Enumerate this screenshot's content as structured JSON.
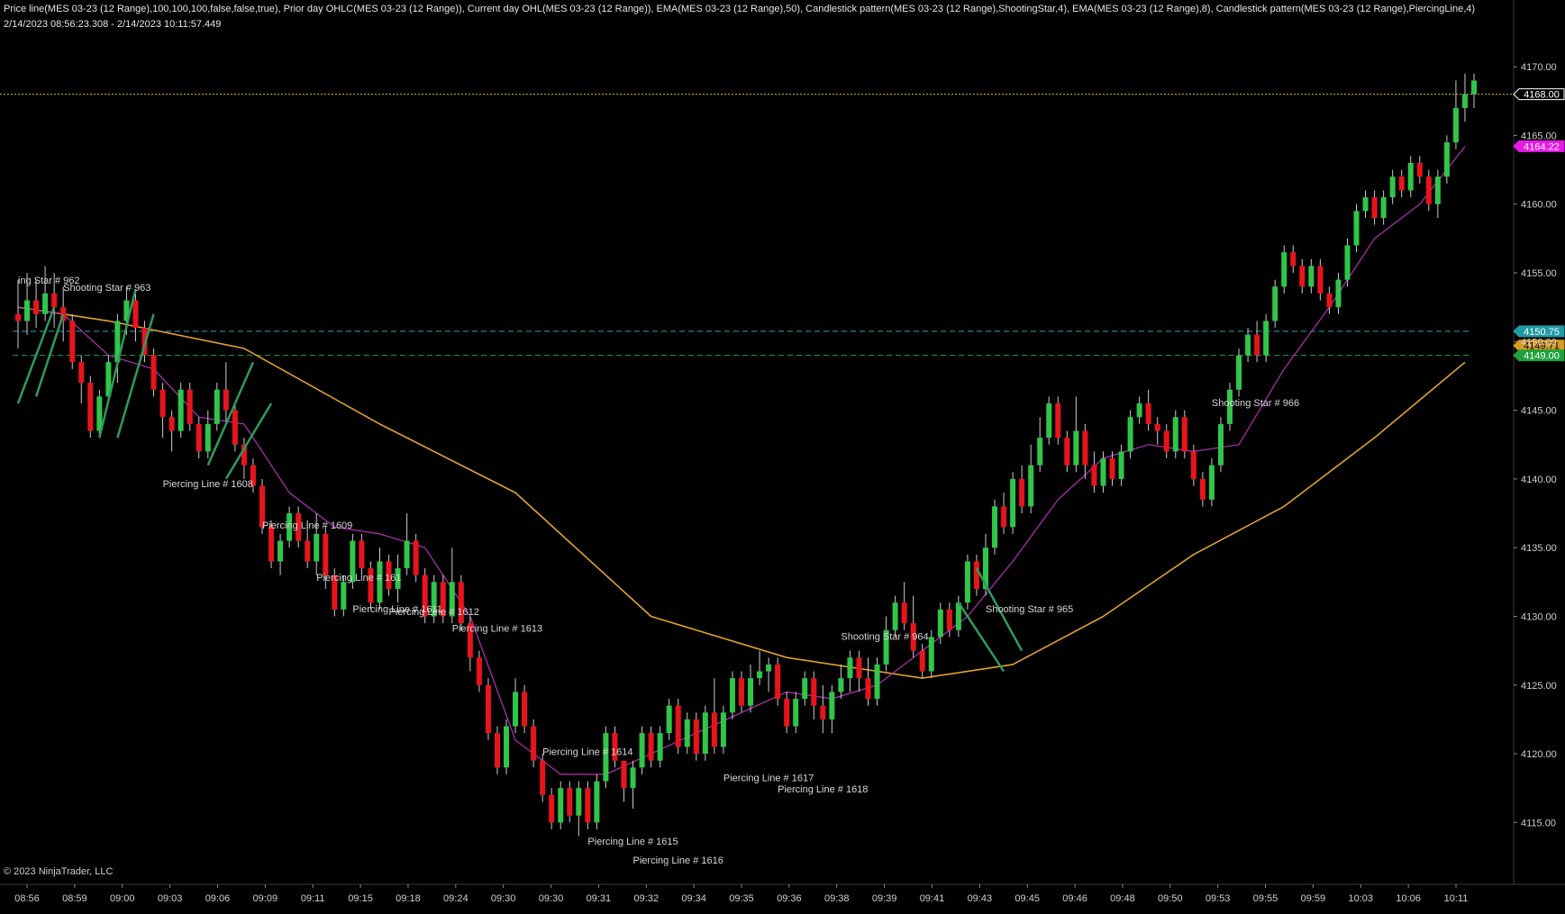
{
  "header": {
    "indicators": "Price line(MES 03-23 (12 Range),100,100,100,false,false,true), Prior day OHLC(MES 03-23 (12 Range)), Current day OHL(MES 03-23 (12 Range)), EMA(MES 03-23 (12 Range),50), Candlestick pattern(MES 03-23 (12 Range),ShootingStar,4), EMA(MES 03-23 (12 Range),8), Candlestick pattern(MES 03-23 (12 Range),PiercingLine,4)",
    "range": "2/14/2023 08:56:23.308 - 2/14/2023 10:11:57.449"
  },
  "footer": {
    "copyright": "© 2023 NinjaTrader, LLC"
  },
  "colors": {
    "background": "#000000",
    "up": "#2fc64a",
    "down": "#e8141c",
    "neutral_up": "#d8d8d8",
    "neutral_down": "#8a8a8a",
    "wick": "#cccccc",
    "ema50": "#e0a22a",
    "ema8": "#b52fb8",
    "price_line": "#d4c01a",
    "prior_line": "#2aa7b2",
    "current_open_line": "#1fa23a",
    "pattern_line": "#2e9b5e",
    "axis_text": "#d0d0d0",
    "label_text": "#d8d8d8"
  },
  "chart_data": {
    "type": "candlestick",
    "y_axis": {
      "ticks": [
        "4170.00",
        "4165.00",
        "4160.00",
        "4155.00",
        "4150.00",
        "4145.00",
        "4140.00",
        "4135.00",
        "4130.00",
        "4125.00",
        "4120.00",
        "4115.00"
      ],
      "range": [
        4110.5,
        4172.5
      ]
    },
    "x_axis": {
      "ticks": [
        "08:56",
        "08:59",
        "09:00",
        "09:03",
        "09:06",
        "09:09",
        "09:11",
        "09:15",
        "09:18",
        "09:24",
        "09:30",
        "09:30",
        "09:31",
        "09:32",
        "09:34",
        "09:35",
        "09:36",
        "09:38",
        "09:39",
        "09:41",
        "09:43",
        "09:45",
        "09:46",
        "09:48",
        "09:50",
        "09:53",
        "09:55",
        "09:59",
        "10:03",
        "10:06",
        "10:11"
      ]
    },
    "price_markers": [
      {
        "label": "4168.00",
        "value": 4168.0,
        "bg": "#000000",
        "fg": "#ffffff",
        "border": "#ffffff"
      },
      {
        "label": "4164.22",
        "value": 4164.22,
        "bg": "#e619e6",
        "fg": "#ffffff",
        "border": "#e619e6"
      },
      {
        "label": "4150.75",
        "value": 4150.75,
        "bg": "#1f9aa6",
        "fg": "#ffffff",
        "border": "#1f9aa6"
      },
      {
        "label": "4149.71",
        "value": 4149.71,
        "bg": "#d69b22",
        "fg": "#000000",
        "border": "#d69b22"
      },
      {
        "label": "4149.00",
        "value": 4149.0,
        "bg": "#1fa23a",
        "fg": "#ffffff",
        "border": "#1fa23a"
      }
    ],
    "horizontal_lines": [
      {
        "name": "Price line",
        "value": 4168.0,
        "style": "dotted"
      },
      {
        "name": "Prior day OHLC",
        "value": 4150.75,
        "style": "dashed"
      },
      {
        "name": "Current day OHL",
        "value": 4149.0,
        "style": "dashed"
      }
    ],
    "candles": [
      [
        4152,
        4151.5,
        4154.5,
        4149.5
      ],
      [
        4151.5,
        4153,
        4155,
        4150.5
      ],
      [
        4153,
        4152,
        4154.5,
        4151
      ],
      [
        4152,
        4153.5,
        4155.5,
        4151.5
      ],
      [
        4153.5,
        4152.5,
        4155,
        4151
      ],
      [
        4152.5,
        4151.5,
        4154,
        4150
      ],
      [
        4151.5,
        4148.5,
        4152,
        4148
      ],
      [
        4148.5,
        4147,
        4149,
        4145.5
      ],
      [
        4147,
        4143.5,
        4147.5,
        4143
      ],
      [
        4143.5,
        4146,
        4146.5,
        4143
      ],
      [
        4146,
        4148.5,
        4149,
        4145.5
      ],
      [
        4148.5,
        4151.5,
        4152,
        4147
      ],
      [
        4151.5,
        4153,
        4154,
        4150.5
      ],
      [
        4153,
        4151,
        4153.5,
        4150
      ],
      [
        4151,
        4149,
        4151.5,
        4148.5
      ],
      [
        4149,
        4146.5,
        4149.5,
        4146
      ],
      [
        4146.5,
        4144.5,
        4147,
        4143
      ],
      [
        4144.5,
        4143.5,
        4145,
        4142
      ],
      [
        4143.5,
        4146.5,
        4147,
        4143
      ],
      [
        4146.5,
        4144,
        4147,
        4143.5
      ],
      [
        4144,
        4142,
        4144.5,
        4141.5
      ],
      [
        4142,
        4144,
        4145,
        4141.5
      ],
      [
        4144,
        4146.5,
        4147,
        4143.5
      ],
      [
        4146.5,
        4145,
        4148.5,
        4144
      ],
      [
        4145,
        4142.5,
        4145.5,
        4142
      ],
      [
        4142.5,
        4141,
        4143,
        4140
      ],
      [
        4141,
        4139.5,
        4141.5,
        4139
      ],
      [
        4139.5,
        4136.5,
        4140,
        4136
      ],
      [
        4136.5,
        4134,
        4137,
        4133.5
      ],
      [
        4134,
        4135.5,
        4136,
        4133
      ],
      [
        4135.5,
        4137.5,
        4138,
        4135
      ],
      [
        4137.5,
        4135.5,
        4138,
        4135
      ],
      [
        4135.5,
        4134,
        4137,
        4133.5
      ],
      [
        4134,
        4136,
        4137.5,
        4133
      ],
      [
        4136,
        4133,
        4136.5,
        4132
      ],
      [
        4133,
        4130.5,
        4133.5,
        4130
      ],
      [
        4130.5,
        4132.5,
        4133,
        4130
      ],
      [
        4132.5,
        4135.5,
        4136,
        4132
      ],
      [
        4135.5,
        4133.5,
        4136,
        4133
      ],
      [
        4133.5,
        4131,
        4134,
        4130.5
      ],
      [
        4131,
        4134,
        4135,
        4130.5
      ],
      [
        4134,
        4132,
        4134.5,
        4131.5
      ],
      [
        4132,
        4133.5,
        4134.5,
        4131
      ],
      [
        4133.5,
        4135.5,
        4137.5,
        4133
      ],
      [
        4135.5,
        4133,
        4136,
        4132.5
      ],
      [
        4133,
        4130,
        4133.5,
        4129.5
      ],
      [
        4130,
        4132.5,
        4133,
        4129.5
      ],
      [
        4132.5,
        4130,
        4133,
        4129.5
      ],
      [
        4130,
        4132.5,
        4135,
        4129.5
      ],
      [
        4132.5,
        4129.5,
        4133,
        4129
      ],
      [
        4129.5,
        4127,
        4130,
        4126
      ],
      [
        4127,
        4125,
        4127.5,
        4124.5
      ],
      [
        4125,
        4121.5,
        4125.5,
        4121
      ],
      [
        4121.5,
        4119,
        4122,
        4118.5
      ],
      [
        4119,
        4122,
        4122.5,
        4118.5
      ],
      [
        4122,
        4124.5,
        4125.5,
        4121.5
      ],
      [
        4124.5,
        4122,
        4125,
        4121.5
      ],
      [
        4122,
        4119.5,
        4122.5,
        4119
      ],
      [
        4119.5,
        4117,
        4120,
        4116.5
      ],
      [
        4117,
        4115,
        4117.5,
        4114.5
      ],
      [
        4115,
        4117.5,
        4118,
        4114.5
      ],
      [
        4117.5,
        4115.5,
        4118,
        4115
      ],
      [
        4115.5,
        4117.5,
        4118,
        4114
      ],
      [
        4117.5,
        4115,
        4118,
        4114.5
      ],
      [
        4115,
        4118,
        4118.5,
        4114.5
      ],
      [
        4118,
        4121.5,
        4122,
        4117.5
      ],
      [
        4121.5,
        4119.5,
        4122,
        4119
      ],
      [
        4119.5,
        4117.5,
        4118.5,
        4116.5
      ],
      [
        4117.5,
        4119,
        4119.5,
        4116
      ],
      [
        4119,
        4121.5,
        4122,
        4118.5
      ],
      [
        4121.5,
        4119.5,
        4122,
        4119
      ],
      [
        4119.5,
        4121.5,
        4122,
        4119
      ],
      [
        4121.5,
        4123.5,
        4124,
        4121
      ],
      [
        4123.5,
        4120.5,
        4124,
        4120
      ],
      [
        4120.5,
        4122.5,
        4123,
        4120
      ],
      [
        4122.5,
        4120,
        4123,
        4119.5
      ],
      [
        4120,
        4123,
        4123.5,
        4119.5
      ],
      [
        4123,
        4120.5,
        4125.5,
        4120
      ],
      [
        4120.5,
        4123,
        4123.5,
        4120
      ],
      [
        4123,
        4125.5,
        4126,
        4122.5
      ],
      [
        4125.5,
        4123.5,
        4126,
        4123
      ],
      [
        4123.5,
        4125.5,
        4126.5,
        4123
      ],
      [
        4125.5,
        4126,
        4127.5,
        4125
      ],
      [
        4126,
        4126.5,
        4127,
        4124.5
      ],
      [
        4126.5,
        4124,
        4127,
        4123.5
      ],
      [
        4124,
        4122,
        4124.5,
        4121.5
      ],
      [
        4122,
        4124,
        4124.5,
        4121.5
      ],
      [
        4124,
        4125.5,
        4126,
        4123.5
      ],
      [
        4125.5,
        4123.5,
        4126,
        4122.5
      ],
      [
        4123.5,
        4122.5,
        4125,
        4121.5
      ],
      [
        4122.5,
        4124.5,
        4125,
        4121.5
      ],
      [
        4124.5,
        4125.5,
        4126.5,
        4124
      ],
      [
        4125.5,
        4127,
        4127.5,
        4124.5
      ],
      [
        4127,
        4125.5,
        4127.5,
        4124.5
      ],
      [
        4125.5,
        4124,
        4127,
        4123.5
      ],
      [
        4124,
        4126.5,
        4127,
        4123.5
      ],
      [
        4126.5,
        4129,
        4130,
        4126
      ],
      [
        4129,
        4131,
        4131.5,
        4128.5
      ],
      [
        4131,
        4129.5,
        4132.5,
        4129
      ],
      [
        4129.5,
        4127.5,
        4131.5,
        4127
      ],
      [
        4127.5,
        4126,
        4128,
        4125.5
      ],
      [
        4126,
        4128.5,
        4129,
        4125.5
      ],
      [
        4128.5,
        4130.5,
        4131,
        4128
      ],
      [
        4130.5,
        4129,
        4131,
        4128.5
      ],
      [
        4129,
        4131,
        4131.5,
        4128.5
      ],
      [
        4131,
        4134,
        4134.5,
        4130.5
      ],
      [
        4134,
        4132,
        4134.5,
        4131.5
      ],
      [
        4132,
        4135,
        4136,
        4131.5
      ],
      [
        4135,
        4138,
        4138.5,
        4134.5
      ],
      [
        4138,
        4136.5,
        4139,
        4136
      ],
      [
        4136.5,
        4140,
        4140.5,
        4136
      ],
      [
        4140,
        4138,
        4141,
        4137.5
      ],
      [
        4138,
        4141,
        4142.5,
        4137.5
      ],
      [
        4141,
        4143,
        4144.5,
        4140.5
      ],
      [
        4143,
        4145.5,
        4146,
        4142.5
      ],
      [
        4145.5,
        4143,
        4146,
        4142.5
      ],
      [
        4143,
        4141,
        4143.5,
        4140.5
      ],
      [
        4141,
        4143.5,
        4146,
        4140.5
      ],
      [
        4143.5,
        4141,
        4144,
        4140
      ],
      [
        4141,
        4139.5,
        4142,
        4139
      ],
      [
        4139.5,
        4141.5,
        4142,
        4139
      ],
      [
        4141.5,
        4140,
        4142,
        4139.5
      ],
      [
        4140,
        4142,
        4142.5,
        4139.5
      ],
      [
        4142,
        4144.5,
        4145,
        4141.5
      ],
      [
        4144.5,
        4145.5,
        4146,
        4144
      ],
      [
        4145.5,
        4144,
        4146.5,
        4143.5
      ],
      [
        4144,
        4143.5,
        4144.5,
        4142.5
      ],
      [
        4143.5,
        4142,
        4144,
        4141.5
      ],
      [
        4142,
        4144.5,
        4145,
        4141.5
      ],
      [
        4144.5,
        4142,
        4145,
        4141.5
      ],
      [
        4142,
        4140,
        4142.5,
        4139.5
      ],
      [
        4140,
        4138.5,
        4140.5,
        4138
      ],
      [
        4138.5,
        4141,
        4141.5,
        4138
      ],
      [
        4141,
        4144,
        4144.5,
        4140.5
      ],
      [
        4144,
        4146.5,
        4147,
        4143.5
      ],
      [
        4146.5,
        4149,
        4149.5,
        4146
      ],
      [
        4149,
        4150.5,
        4151,
        4148.5
      ],
      [
        4150.5,
        4149,
        4151.5,
        4148.5
      ],
      [
        4149,
        4151.5,
        4152,
        4148.5
      ],
      [
        4151.5,
        4154,
        4154.5,
        4151
      ],
      [
        4154,
        4156.5,
        4157,
        4153.5
      ],
      [
        4156.5,
        4155.5,
        4157,
        4155
      ],
      [
        4155.5,
        4154,
        4156,
        4153.5
      ],
      [
        4154,
        4155.5,
        4156,
        4153.5
      ],
      [
        4155.5,
        4153.5,
        4156,
        4153
      ],
      [
        4153.5,
        4152.5,
        4154,
        4152
      ],
      [
        4152.5,
        4154.5,
        4155,
        4152
      ],
      [
        4154.5,
        4157,
        4157.5,
        4154
      ],
      [
        4157,
        4159.5,
        4160,
        4156.5
      ],
      [
        4159.5,
        4160.5,
        4161,
        4159
      ],
      [
        4160.5,
        4159,
        4161,
        4158.5
      ],
      [
        4159,
        4160.5,
        4161,
        4158.5
      ],
      [
        4160.5,
        4162,
        4162.5,
        4160
      ],
      [
        4162,
        4161,
        4162.5,
        4160.5
      ],
      [
        4161,
        4163,
        4163.5,
        4160.5
      ],
      [
        4163,
        4162,
        4163.5,
        4161.5
      ],
      [
        4162,
        4160,
        4162.5,
        4159.5
      ],
      [
        4160,
        4162,
        4162.5,
        4159
      ],
      [
        4162,
        4164.5,
        4165,
        4161.5
      ],
      [
        4164.5,
        4167,
        4169,
        4164
      ],
      [
        4167,
        4168,
        4169.5,
        4166
      ],
      [
        4168,
        4169,
        4169.5,
        4167
      ]
    ],
    "ema50": [
      [
        0,
        4152.5
      ],
      [
        10,
        4151.5
      ],
      [
        25,
        4149.5
      ],
      [
        40,
        4144
      ],
      [
        55,
        4139
      ],
      [
        70,
        4130
      ],
      [
        85,
        4127
      ],
      [
        100,
        4125.5
      ],
      [
        110,
        4126.5
      ],
      [
        120,
        4130
      ],
      [
        130,
        4134.5
      ],
      [
        140,
        4138
      ],
      [
        150,
        4143
      ],
      [
        160,
        4148.5
      ]
    ],
    "ema8": [
      [
        0,
        4152.5
      ],
      [
        5,
        4152
      ],
      [
        10,
        4149
      ],
      [
        15,
        4148
      ],
      [
        20,
        4144.5
      ],
      [
        25,
        4144
      ],
      [
        30,
        4139
      ],
      [
        35,
        4136.5
      ],
      [
        40,
        4136
      ],
      [
        45,
        4135
      ],
      [
        50,
        4130
      ],
      [
        55,
        4121
      ],
      [
        60,
        4118.5
      ],
      [
        65,
        4118.5
      ],
      [
        70,
        4120
      ],
      [
        75,
        4121.5
      ],
      [
        80,
        4123
      ],
      [
        85,
        4124.5
      ],
      [
        90,
        4124
      ],
      [
        95,
        4125
      ],
      [
        100,
        4127.5
      ],
      [
        105,
        4130
      ],
      [
        110,
        4134
      ],
      [
        115,
        4138.5
      ],
      [
        120,
        4141.5
      ],
      [
        125,
        4142.5
      ],
      [
        130,
        4142
      ],
      [
        135,
        4142.5
      ],
      [
        140,
        4148
      ],
      [
        145,
        4152.5
      ],
      [
        150,
        4157.5
      ],
      [
        155,
        4160
      ],
      [
        160,
        4164.2
      ]
    ],
    "pattern_labels": [
      {
        "text": "ing Star # 962",
        "bar": 0,
        "value": 4154.2
      },
      {
        "text": "Shooting Star # 963",
        "bar": 5,
        "value": 4153.7
      },
      {
        "text": "Piercing Line # 1608",
        "bar": 16,
        "value": 4139.4
      },
      {
        "text": "Piercing Line # 1609",
        "bar": 27,
        "value": 4136.4
      },
      {
        "text": "Piercing Line # 161",
        "bar": 33,
        "value": 4132.6
      },
      {
        "text": "Piercing Line # 1611",
        "bar": 37,
        "value": 4130.3
      },
      {
        "text": "Piercing Line # 1612",
        "bar": 41,
        "value": 4130.1
      },
      {
        "text": "Piercing Line # 1613",
        "bar": 48,
        "value": 4128.9
      },
      {
        "text": "Piercing Line # 1614",
        "bar": 58,
        "value": 4119.9
      },
      {
        "text": "Shooting Star # 964",
        "bar": 91,
        "value": 4128.3
      },
      {
        "text": "Piercing Line # 1617",
        "bar": 78,
        "value": 4118.0
      },
      {
        "text": "Piercing Line # 1618",
        "bar": 84,
        "value": 4117.2
      },
      {
        "text": "Piercing Line # 1615",
        "bar": 63,
        "value": 4113.4
      },
      {
        "text": "Piercing Line # 1616",
        "bar": 68,
        "value": 4112.0
      },
      {
        "text": "Shooting Star # 965",
        "bar": 107,
        "value": 4130.3
      },
      {
        "text": "Shooting Star # 966",
        "bar": 132,
        "value": 4145.3
      }
    ],
    "pattern_lines": [
      [
        [
          0,
          4145.5
        ],
        [
          4,
          4152.5
        ]
      ],
      [
        [
          2,
          4146
        ],
        [
          5,
          4152
        ]
      ],
      [
        [
          9,
          4143
        ],
        [
          13,
          4153.8
        ]
      ],
      [
        [
          11,
          4143
        ],
        [
          15,
          4152
        ]
      ],
      [
        [
          21,
          4141
        ],
        [
          26,
          4148.5
        ]
      ],
      [
        [
          23,
          4140
        ],
        [
          28,
          4145.5
        ]
      ],
      [
        [
          104,
          4131
        ],
        [
          109,
          4126
        ]
      ],
      [
        [
          106,
          4133.5
        ],
        [
          111,
          4127.5
        ]
      ]
    ]
  }
}
